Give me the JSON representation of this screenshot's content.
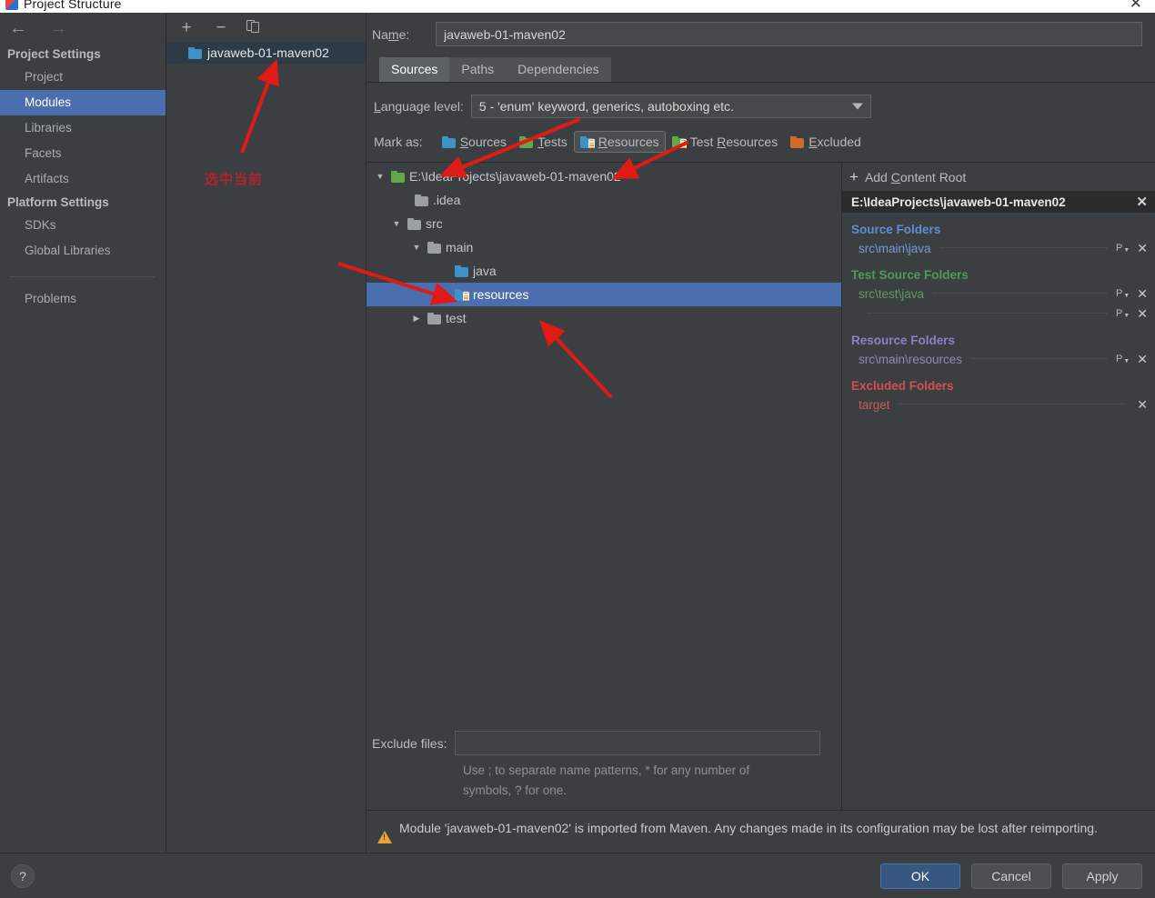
{
  "window": {
    "title": "Project Structure",
    "close_label": "✕",
    "app_icon": "intellij-idea-icon"
  },
  "nav": {
    "back_icon": "←",
    "forward_icon": "→"
  },
  "sidebar": {
    "sections": [
      {
        "title": "Project Settings",
        "items": [
          {
            "label": "Project",
            "selected": false
          },
          {
            "label": "Modules",
            "selected": true
          },
          {
            "label": "Libraries",
            "selected": false
          },
          {
            "label": "Facets",
            "selected": false
          },
          {
            "label": "Artifacts",
            "selected": false
          }
        ]
      },
      {
        "title": "Platform Settings",
        "items": [
          {
            "label": "SDKs",
            "selected": false
          },
          {
            "label": "Global Libraries",
            "selected": false
          }
        ]
      }
    ],
    "problems_label": "Problems"
  },
  "modules_panel": {
    "toolbar": {
      "add_label": "+",
      "remove_label": "−",
      "copy_label": "copy-icon"
    },
    "modules": [
      {
        "label": "javaweb-01-maven02",
        "selected": true
      }
    ],
    "annotation": "选中当前"
  },
  "module_editor": {
    "name_label_pre": "Na",
    "name_label_mnemonic": "m",
    "name_label_post": "e:",
    "name_value": "javaweb-01-maven02",
    "tabs": [
      {
        "label": "Sources",
        "active": true
      },
      {
        "label": "Paths",
        "active": false
      },
      {
        "label": "Dependencies",
        "active": false
      }
    ],
    "language_level": {
      "label_mnemonic": "L",
      "label_rest": "anguage level:",
      "value": "5 - 'enum' keyword, generics, autoboxing etc.",
      "caret_icon": "chevron-down-icon"
    },
    "mark_as": {
      "label": "Mark as:",
      "buttons": [
        {
          "pre": "",
          "mnemonic": "S",
          "post": "ources",
          "icon": "folder-blue-icon",
          "kind": "blue",
          "pressed": false
        },
        {
          "pre": "",
          "mnemonic": "T",
          "post": "ests",
          "icon": "folder-green-icon",
          "kind": "green",
          "pressed": false
        },
        {
          "pre": "",
          "mnemonic": "R",
          "post": "esources",
          "icon": "folder-resources-icon",
          "kind": "blue-res",
          "pressed": true
        },
        {
          "pre": "Test ",
          "mnemonic": "R",
          "post": "esources",
          "icon": "folder-test-resources-icon",
          "kind": "green-res",
          "pressed": false
        },
        {
          "pre": "",
          "mnemonic": "E",
          "post": "xcluded",
          "icon": "folder-orange-icon",
          "kind": "orange",
          "pressed": false
        }
      ]
    },
    "tree": [
      {
        "label": "E:\\IdeaProjects\\javaweb-01-maven02",
        "indent": 0,
        "twist": "▼",
        "icon": "folder-green-icon",
        "kind": "green",
        "selected": false
      },
      {
        "label": ".idea",
        "indent": 1,
        "twist": "",
        "icon": "folder-gray-icon",
        "kind": "gray",
        "selected": false
      },
      {
        "label": "src",
        "indent": 1,
        "twist": "▼",
        "icon": "folder-gray-icon",
        "kind": "gray",
        "selected": false
      },
      {
        "label": "main",
        "indent": 2,
        "twist": "▼",
        "icon": "folder-gray-icon",
        "kind": "gray",
        "selected": false
      },
      {
        "label": "java",
        "indent": 3,
        "twist": "",
        "icon": "folder-blue-icon",
        "kind": "blue",
        "selected": false
      },
      {
        "label": "resources",
        "indent": 3,
        "twist": "",
        "icon": "folder-resources-icon",
        "kind": "blue-res",
        "selected": true
      },
      {
        "label": "test",
        "indent": 2,
        "twist": "▶",
        "icon": "folder-gray-icon",
        "kind": "gray",
        "selected": false
      }
    ],
    "exclude_files": {
      "label": "Exclude files:",
      "value": "",
      "hint_line1": "Use ; to separate name patterns, * for any number of",
      "hint_line2": "symbols, ? for one."
    },
    "warning": "Module 'javaweb-01-maven02' is imported from Maven. Any changes made in its configuration may be lost after reimporting."
  },
  "content_roots": {
    "add_label_pre": "Add ",
    "add_label_mnemonic": "C",
    "add_label_post": "ontent Root",
    "add_icon": "plus-icon",
    "root_path": "E:\\IdeaProjects\\javaweb-01-maven02",
    "root_close_icon": "✕",
    "groups": [
      {
        "title": "Source Folders",
        "kind": "src",
        "color": "#5e8dd6",
        "entries": [
          {
            "path": "src\\main\\java",
            "has_package_prefix": true,
            "has_remove": true
          }
        ]
      },
      {
        "title": "Test Source Folders",
        "kind": "test",
        "color": "#4f9a56",
        "entries": [
          {
            "path": "src\\test\\java",
            "has_package_prefix": true,
            "has_remove": true
          },
          {
            "path": "",
            "has_package_prefix": true,
            "has_remove": true
          }
        ]
      },
      {
        "title": "Resource Folders",
        "kind": "res",
        "color": "#8b7fc6",
        "entries": [
          {
            "path": "src\\main\\resources",
            "has_package_prefix": true,
            "has_remove": true
          }
        ]
      },
      {
        "title": "Excluded Folders",
        "kind": "exc",
        "color": "#d2504f",
        "entries": [
          {
            "path": "target",
            "has_package_prefix": false,
            "has_remove": true
          }
        ]
      }
    ]
  },
  "footer": {
    "help_label": "?",
    "buttons": [
      {
        "label": "OK",
        "primary": true
      },
      {
        "label": "Cancel",
        "primary": false
      },
      {
        "label": "Apply",
        "primary": false
      }
    ]
  },
  "colors": {
    "window_bg": "#3c3f41",
    "selection_blue": "#4b6eaf",
    "primary_button": "#365880",
    "annotation_red": "#c9202a",
    "warning_amber": "#e8a33d",
    "source_blue": "#5e8dd6",
    "test_green": "#4f9a56",
    "resource_purple": "#8b7fc6",
    "excluded_red": "#d2504f"
  }
}
